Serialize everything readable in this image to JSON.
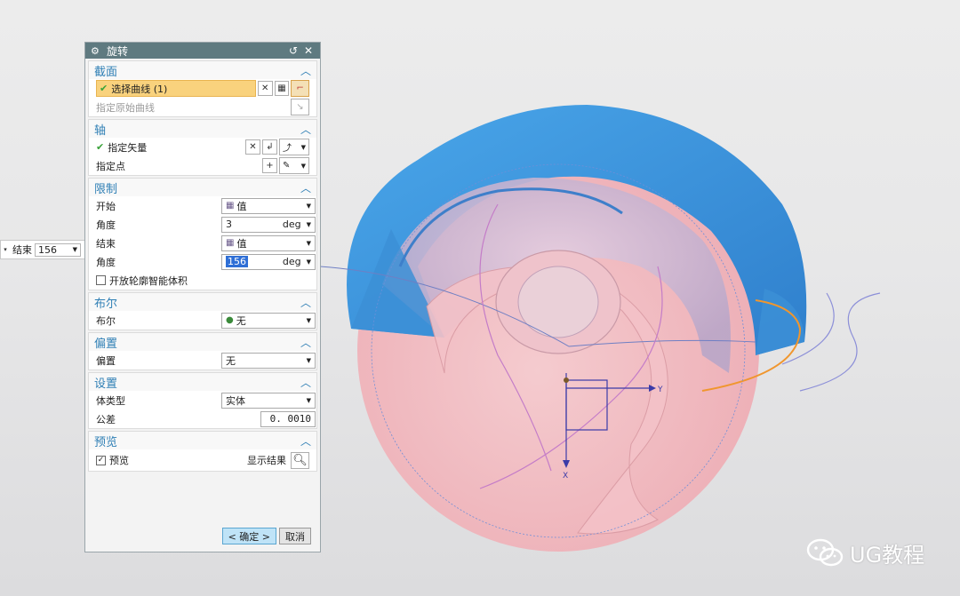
{
  "mini_widget": {
    "label": "结束",
    "value": "156"
  },
  "dialog": {
    "title": "旋转",
    "sections": {
      "section": {
        "title": "截面",
        "select_curve": "选择曲线 (1)",
        "specify_origin_curve": "指定原始曲线"
      },
      "axis": {
        "title": "轴",
        "specify_vector": "指定矢量",
        "specify_point": "指定点"
      },
      "limits": {
        "title": "限制",
        "start_label": "开始",
        "start_value": "值",
        "start_angle_label": "角度",
        "start_angle": "3",
        "end_label": "结束",
        "end_value": "值",
        "end_angle_label": "角度",
        "end_angle": "156",
        "unit": "deg",
        "open_profile": "开放轮廓智能体积"
      },
      "boolean": {
        "title": "布尔",
        "label": "布尔",
        "value": "无"
      },
      "offset": {
        "title": "偏置",
        "label": "偏置",
        "value": "无"
      },
      "settings": {
        "title": "设置",
        "body_type_label": "体类型",
        "body_type": "实体",
        "tolerance_label": "公差",
        "tolerance": "0. 0010"
      },
      "preview": {
        "title": "预览",
        "checkbox": "预览",
        "show_result": "显示结果"
      }
    },
    "buttons": {
      "ok": "< 确定 >",
      "cancel": "取消"
    }
  },
  "viewport": {
    "axis_y": "Y",
    "axis_x": "X"
  },
  "watermark": {
    "text": "UG教程"
  },
  "colors": {
    "title_bar": "#5f7a80",
    "section_title": "#2f7fb5",
    "highlight": "#f9d27d",
    "shell_blue": "#3d95db",
    "body_pink": "#f2b6bd"
  }
}
